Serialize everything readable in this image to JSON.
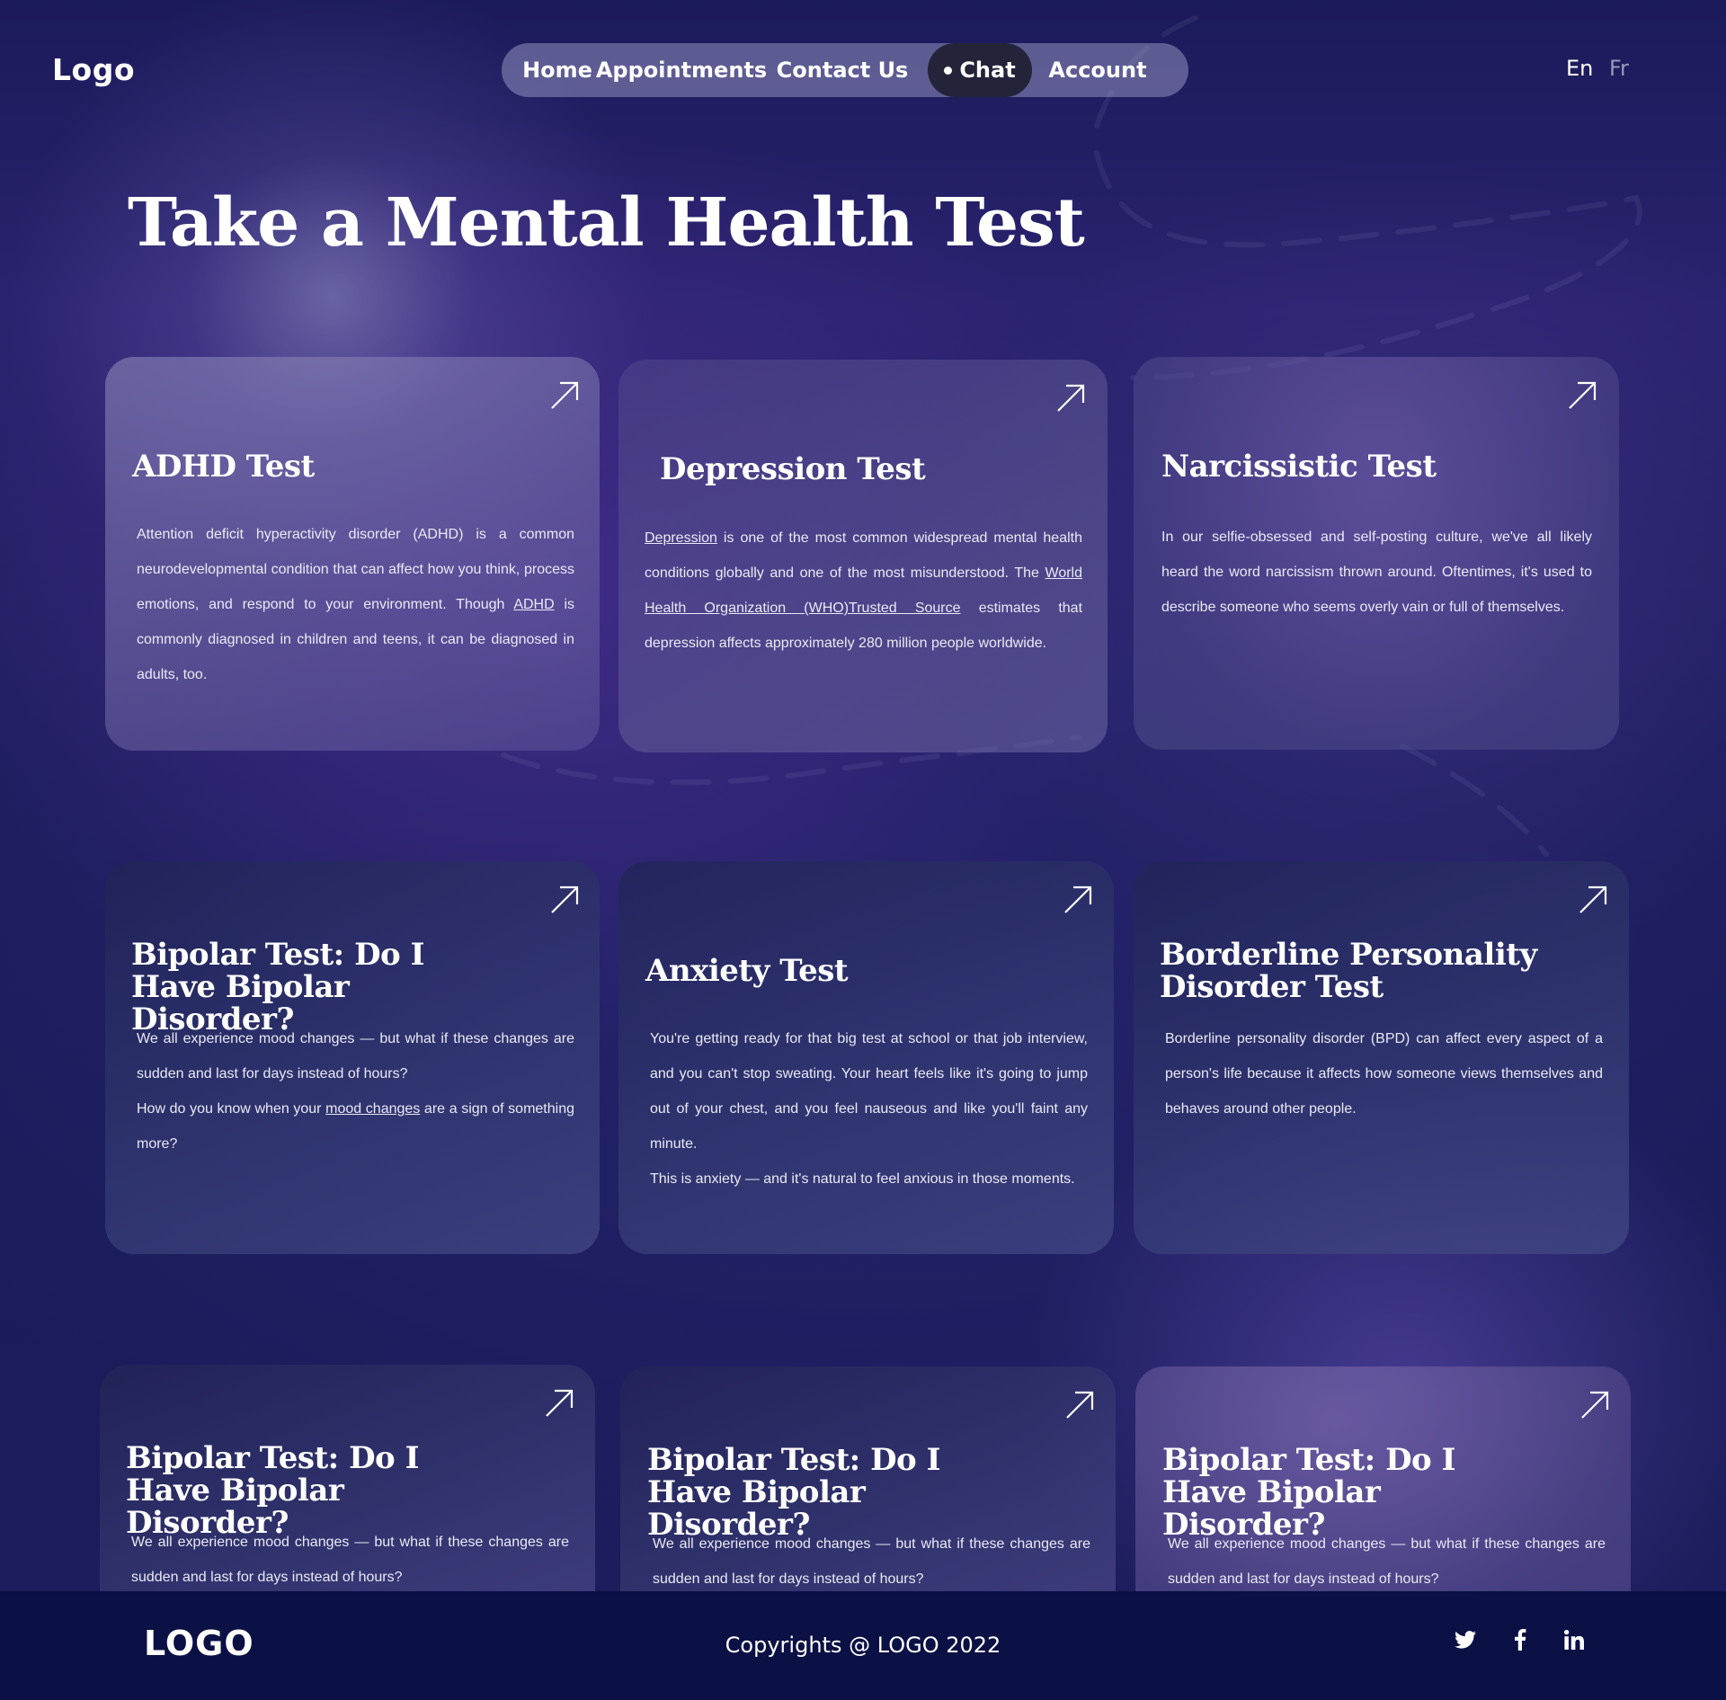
{
  "header": {
    "logo": "Logo",
    "nav": [
      {
        "label": "Home"
      },
      {
        "label": "Appointments"
      },
      {
        "label": "Contact Us"
      },
      {
        "label": "Chat",
        "active": true
      },
      {
        "label": "Account"
      }
    ],
    "languages": [
      "En",
      "Fr"
    ],
    "active_language": "En"
  },
  "page_title": "Take a Mental Health Test",
  "cards": [
    {
      "title": "ADHD Test",
      "desc": [
        "Attention deficit hyperactivity disorder (ADHD) is a common neurodevelopmental condition that can affect how you think, process emotions, and respond to your environment. Though ",
        "ADHD",
        " is commonly diagnosed in children and teens, it can be diagnosed in adults, too."
      ]
    },
    {
      "title": "Depression Test",
      "desc": [
        "Depression",
        " is one of the most common widespread mental health conditions globally and one of the most misunderstood. The ",
        "World Health Organization (WHO)Trusted Source",
        " estimates that depression affects approximately 280 million people worldwide."
      ]
    },
    {
      "title": "Narcissistic Test",
      "desc": [
        "In our selfie-obsessed and self-posting culture, we've all likely heard the word narcissism thrown around. Oftentimes, it's used to describe someone who seems overly vain or full of themselves."
      ]
    },
    {
      "title": "Bipolar Test: Do I Have Bipolar Disorder?",
      "desc": [
        "We all experience mood changes — but what if these changes are sudden and last for days instead of hours?",
        "How do you know when your ",
        "mood changes",
        " are a sign of something more?"
      ]
    },
    {
      "title": "Anxiety Test",
      "desc": [
        "You're getting ready for that big test at school or that job interview, and you can't stop sweating. Your heart feels like it's going to jump out of your chest, and you feel nauseous and like you'll faint any minute.",
        "This is anxiety — and it's natural to feel anxious in those moments."
      ]
    },
    {
      "title": "Borderline Personality Disorder Test",
      "desc": [
        "Borderline personality disorder (BPD) can affect every aspect of a person's life because it affects how someone views themselves and behaves around other people."
      ]
    },
    {
      "title": "Bipolar Test: Do I Have Bipolar Disorder?",
      "desc": [
        "We all experience mood changes — but what if these changes are sudden and last for days instead of hours?"
      ]
    },
    {
      "title": "Bipolar Test: Do I Have Bipolar Disorder?",
      "desc": [
        "We all experience mood changes — but what if these changes are sudden and last for days instead of hours?"
      ]
    },
    {
      "title": "Bipolar Test: Do I Have Bipolar Disorder?",
      "desc": [
        "We all experience mood changes — but what if these changes are sudden and last for days instead of hours?"
      ]
    }
  ],
  "card_icon": "arrow-up-right-icon",
  "footer": {
    "logo": "LOGO",
    "copyright": "Copyrights @ LOGO 2022",
    "social": [
      "twitter-icon",
      "facebook-icon",
      "linkedin-icon"
    ]
  },
  "colors": {
    "background": "#1d1d5e",
    "footer": "#0b1045",
    "nav_pill": "#8d8db8",
    "active_nav": "#23233a",
    "text": "#ffffff"
  }
}
